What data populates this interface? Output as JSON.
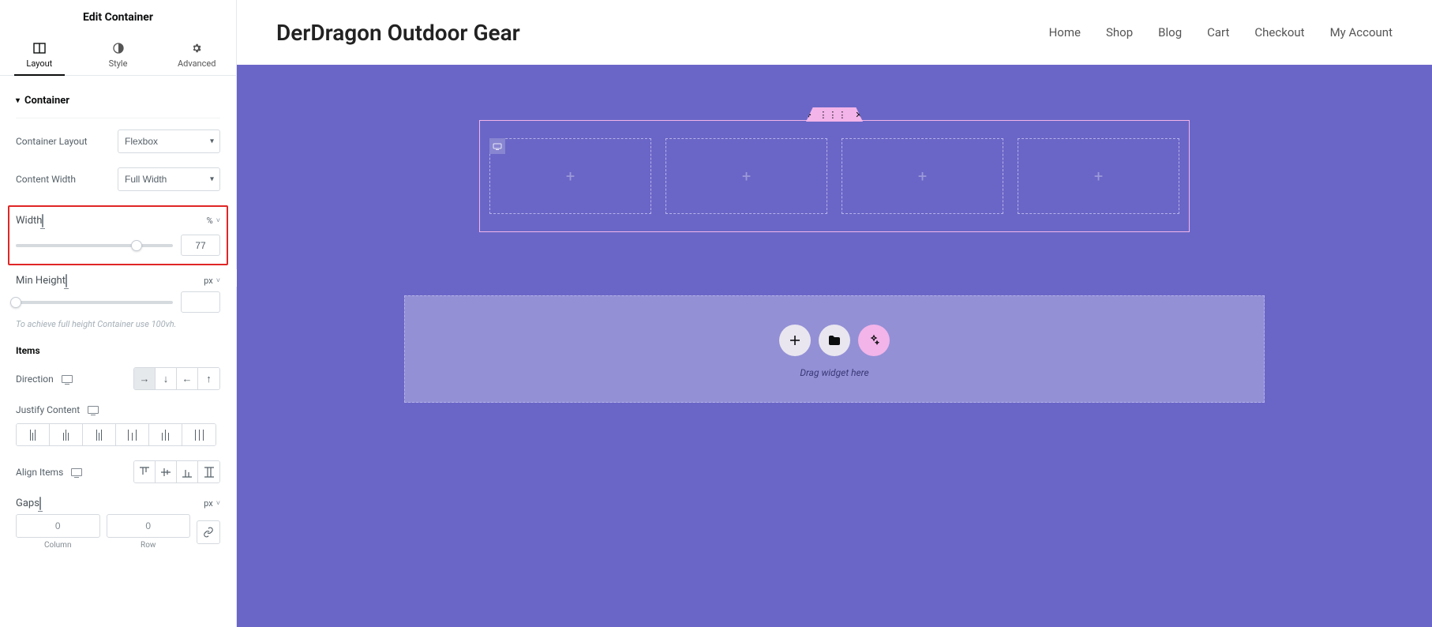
{
  "sidebar": {
    "title": "Edit Container",
    "tabs": {
      "layout": "Layout",
      "style": "Style",
      "advanced": "Advanced"
    },
    "section": {
      "container": "Container"
    },
    "labels": {
      "container_layout": "Container Layout",
      "content_width": "Content Width",
      "width": "Width",
      "min_height": "Min Height",
      "items": "Items",
      "direction": "Direction",
      "justify_content": "Justify Content",
      "align_items": "Align Items",
      "gaps": "Gaps"
    },
    "values": {
      "container_layout": "Flexbox",
      "content_width": "Full Width",
      "width_unit": "%",
      "width_value": "77",
      "min_height_unit": "px",
      "min_height_value": "",
      "gaps_unit": "px",
      "gap_col": "0",
      "gap_row": "0"
    },
    "hint_full_height": "To achieve full height Container use 100vh.",
    "gap_sub": {
      "column": "Column",
      "row": "Row"
    }
  },
  "preview": {
    "site_title": "DerDragon Outdoor Gear",
    "nav": {
      "home": "Home",
      "shop": "Shop",
      "blog": "Blog",
      "cart": "Cart",
      "checkout": "Checkout",
      "account": "My Account"
    },
    "dropzone_hint": "Drag widget here"
  }
}
